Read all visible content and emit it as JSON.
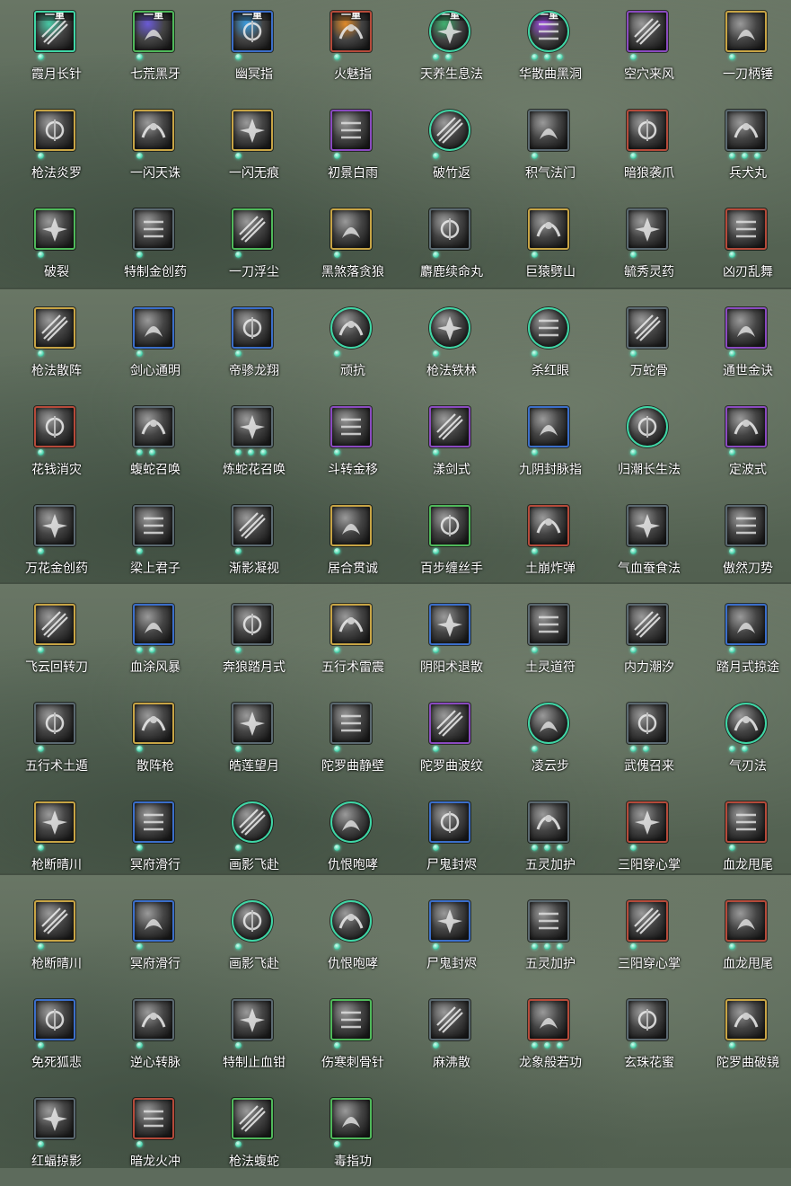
{
  "skills": [
    {
      "label": "霞月长针",
      "tier": "一重",
      "frame": "#3fd6a5",
      "shape": "square",
      "art": "#46c9a5",
      "dots": 1
    },
    {
      "label": "七荒黑牙",
      "tier": "一重",
      "frame": "#4fb85a",
      "shape": "square",
      "art": "#6a5ad6",
      "dots": 1
    },
    {
      "label": "幽冥指",
      "tier": "一重",
      "frame": "#3b6ec9",
      "shape": "square",
      "art": "#3c9de0",
      "dots": 1
    },
    {
      "label": "火魅指",
      "tier": "一重",
      "frame": "#b54a3a",
      "shape": "square",
      "art": "#e08a2a",
      "dots": 1
    },
    {
      "label": "天养生息法",
      "tier": "一重",
      "frame": "#3fd6a5",
      "shape": "circle",
      "art": "#3fb070",
      "dots": 2
    },
    {
      "label": "华散曲黑洞",
      "tier": "一重",
      "frame": "#3fd6a5",
      "shape": "circle",
      "art": "#9a4ae0",
      "dots": 3
    },
    {
      "label": "空穴来风",
      "tier": "",
      "frame": "#8a4ac0",
      "shape": "square",
      "art": "#9a9a9a",
      "dots": 1
    },
    {
      "label": "一刀柄锤",
      "tier": "",
      "frame": "#c7a445",
      "shape": "square",
      "art": "#9a9a9a",
      "dots": 1
    },
    {
      "label": "枪法炎罗",
      "tier": "",
      "frame": "#c7a445",
      "shape": "square",
      "art": "#9a9a9a",
      "dots": 1
    },
    {
      "label": "一闪天诛",
      "tier": "",
      "frame": "#c7a445",
      "shape": "square",
      "art": "#9a9a9a",
      "dots": 1
    },
    {
      "label": "一闪无痕",
      "tier": "",
      "frame": "#c7a445",
      "shape": "square",
      "art": "#9a9a9a",
      "dots": 1
    },
    {
      "label": "初景白雨",
      "tier": "",
      "frame": "#8a4ac0",
      "shape": "square",
      "art": "#9a9a9a",
      "dots": 1
    },
    {
      "label": "破竹返",
      "tier": "",
      "frame": "#3fd6a5",
      "shape": "circle",
      "art": "#9a9a9a",
      "dots": 1
    },
    {
      "label": "积气法门",
      "tier": "",
      "frame": "#5a6870",
      "shape": "square",
      "art": "#9a9a9a",
      "dots": 1
    },
    {
      "label": "暗狼袭爪",
      "tier": "",
      "frame": "#b54a3a",
      "shape": "square",
      "art": "#9a9a9a",
      "dots": 1
    },
    {
      "label": "兵犬丸",
      "tier": "",
      "frame": "#5a6870",
      "shape": "square",
      "art": "#9a9a9a",
      "dots": 3
    },
    {
      "label": "破裂",
      "tier": "",
      "frame": "#4fb85a",
      "shape": "square",
      "art": "#9a9a9a",
      "dots": 1
    },
    {
      "label": "特制金创药",
      "tier": "",
      "frame": "#5a6870",
      "shape": "square",
      "art": "#9a9a9a",
      "dots": 1
    },
    {
      "label": "一刀浮尘",
      "tier": "",
      "frame": "#4fb85a",
      "shape": "square",
      "art": "#9a9a9a",
      "dots": 1
    },
    {
      "label": "黑煞落贪狼",
      "tier": "",
      "frame": "#c7a445",
      "shape": "square",
      "art": "#9a9a9a",
      "dots": 1
    },
    {
      "label": "麝鹿续命丸",
      "tier": "",
      "frame": "#5a6870",
      "shape": "square",
      "art": "#9a9a9a",
      "dots": 1
    },
    {
      "label": "巨猿劈山",
      "tier": "",
      "frame": "#c7a445",
      "shape": "square",
      "art": "#9a9a9a",
      "dots": 1
    },
    {
      "label": "毓秀灵药",
      "tier": "",
      "frame": "#5a6870",
      "shape": "square",
      "art": "#9a9a9a",
      "dots": 1
    },
    {
      "label": "凶刃乱舞",
      "tier": "",
      "frame": "#b54a3a",
      "shape": "square",
      "art": "#9a9a9a",
      "dots": 1
    },
    {
      "label": "枪法散阵",
      "tier": "",
      "frame": "#c7a445",
      "shape": "square",
      "art": "#9a9a9a",
      "dots": 1
    },
    {
      "label": "剑心通明",
      "tier": "",
      "frame": "#3b6ec9",
      "shape": "square",
      "art": "#9a9a9a",
      "dots": 1
    },
    {
      "label": "帝骖龙翔",
      "tier": "",
      "frame": "#3b6ec9",
      "shape": "square",
      "art": "#9a9a9a",
      "dots": 1
    },
    {
      "label": "顽抗",
      "tier": "",
      "frame": "#3fd6a5",
      "shape": "circle",
      "art": "#9a9a9a",
      "dots": 1
    },
    {
      "label": "枪法铁林",
      "tier": "",
      "frame": "#3fd6a5",
      "shape": "circle",
      "art": "#9a9a9a",
      "dots": 1
    },
    {
      "label": "杀红眼",
      "tier": "",
      "frame": "#3fd6a5",
      "shape": "circle",
      "art": "#9a9a9a",
      "dots": 1
    },
    {
      "label": "万蛇骨",
      "tier": "",
      "frame": "#5a6870",
      "shape": "square",
      "art": "#9a9a9a",
      "dots": 1
    },
    {
      "label": "通世金诀",
      "tier": "",
      "frame": "#8a4ac0",
      "shape": "square",
      "art": "#9a9a9a",
      "dots": 1
    },
    {
      "label": "花钱消灾",
      "tier": "",
      "frame": "#b54a3a",
      "shape": "square",
      "art": "#9a9a9a",
      "dots": 1
    },
    {
      "label": "蝮蛇召唤",
      "tier": "",
      "frame": "#5a6870",
      "shape": "square",
      "art": "#9a9a9a",
      "dots": 2
    },
    {
      "label": "炼蛇花召唤",
      "tier": "",
      "frame": "#5a6870",
      "shape": "square",
      "art": "#9a9a9a",
      "dots": 3
    },
    {
      "label": "斗转金移",
      "tier": "",
      "frame": "#8a4ac0",
      "shape": "square",
      "art": "#9a9a9a",
      "dots": 1
    },
    {
      "label": "漾剑式",
      "tier": "",
      "frame": "#8a4ac0",
      "shape": "square",
      "art": "#9a9a9a",
      "dots": 1
    },
    {
      "label": "九阴封脉指",
      "tier": "",
      "frame": "#3b6ec9",
      "shape": "square",
      "art": "#9a9a9a",
      "dots": 1
    },
    {
      "label": "归潮长生法",
      "tier": "",
      "frame": "#3fd6a5",
      "shape": "circle",
      "art": "#9a9a9a",
      "dots": 1
    },
    {
      "label": "定波式",
      "tier": "",
      "frame": "#8a4ac0",
      "shape": "square",
      "art": "#9a9a9a",
      "dots": 1
    },
    {
      "label": "万花金创药",
      "tier": "",
      "frame": "#5a6870",
      "shape": "square",
      "art": "#9a9a9a",
      "dots": 1
    },
    {
      "label": "梁上君子",
      "tier": "",
      "frame": "#5a6870",
      "shape": "square",
      "art": "#9a9a9a",
      "dots": 1
    },
    {
      "label": "渐影凝视",
      "tier": "",
      "frame": "#5a6870",
      "shape": "square",
      "art": "#9a9a9a",
      "dots": 1
    },
    {
      "label": "居合贯诚",
      "tier": "",
      "frame": "#c7a445",
      "shape": "square",
      "art": "#9a9a9a",
      "dots": 1
    },
    {
      "label": "百步缠丝手",
      "tier": "",
      "frame": "#4fb85a",
      "shape": "square",
      "art": "#9a9a9a",
      "dots": 1
    },
    {
      "label": "土崩炸弹",
      "tier": "",
      "frame": "#b54a3a",
      "shape": "square",
      "art": "#9a9a9a",
      "dots": 1
    },
    {
      "label": "气血蚕食法",
      "tier": "",
      "frame": "#5a6870",
      "shape": "square",
      "art": "#9a9a9a",
      "dots": 1
    },
    {
      "label": "傲然刀势",
      "tier": "",
      "frame": "#5a6870",
      "shape": "square",
      "art": "#9a9a9a",
      "dots": 1
    },
    {
      "label": "飞云回转刀",
      "tier": "",
      "frame": "#c7a445",
      "shape": "square",
      "art": "#9a9a9a",
      "dots": 1
    },
    {
      "label": "血涂风暴",
      "tier": "",
      "frame": "#3b6ec9",
      "shape": "square",
      "art": "#9a9a9a",
      "dots": 2
    },
    {
      "label": "奔狼踏月式",
      "tier": "",
      "frame": "#5a6870",
      "shape": "square",
      "art": "#9a9a9a",
      "dots": 1
    },
    {
      "label": "五行术雷震",
      "tier": "",
      "frame": "#c7a445",
      "shape": "square",
      "art": "#9a9a9a",
      "dots": 1
    },
    {
      "label": "阴阳术退散",
      "tier": "",
      "frame": "#3b6ec9",
      "shape": "square",
      "art": "#9a9a9a",
      "dots": 1
    },
    {
      "label": "土灵道符",
      "tier": "",
      "frame": "#5a6870",
      "shape": "square",
      "art": "#9a9a9a",
      "dots": 1
    },
    {
      "label": "内力潮汐",
      "tier": "",
      "frame": "#5a6870",
      "shape": "square",
      "art": "#9a9a9a",
      "dots": 1
    },
    {
      "label": "踏月式掠途",
      "tier": "",
      "frame": "#3b6ec9",
      "shape": "square",
      "art": "#9a9a9a",
      "dots": 1
    },
    {
      "label": "五行术土遁",
      "tier": "",
      "frame": "#5a6870",
      "shape": "square",
      "art": "#9a9a9a",
      "dots": 1
    },
    {
      "label": "散阵枪",
      "tier": "",
      "frame": "#c7a445",
      "shape": "square",
      "art": "#9a9a9a",
      "dots": 1
    },
    {
      "label": "皓莲望月",
      "tier": "",
      "frame": "#5a6870",
      "shape": "square",
      "art": "#9a9a9a",
      "dots": 1
    },
    {
      "label": "陀罗曲静壁",
      "tier": "",
      "frame": "#5a6870",
      "shape": "square",
      "art": "#9a9a9a",
      "dots": 1
    },
    {
      "label": "陀罗曲波纹",
      "tier": "",
      "frame": "#8a4ac0",
      "shape": "square",
      "art": "#9a9a9a",
      "dots": 1
    },
    {
      "label": "凌云步",
      "tier": "",
      "frame": "#3fd6a5",
      "shape": "circle",
      "art": "#9a9a9a",
      "dots": 1
    },
    {
      "label": "武傀召来",
      "tier": "",
      "frame": "#5a6870",
      "shape": "square",
      "art": "#9a9a9a",
      "dots": 2
    },
    {
      "label": "气刃法",
      "tier": "",
      "frame": "#3fd6a5",
      "shape": "circle",
      "art": "#9a9a9a",
      "dots": 2
    },
    {
      "label": "枪断晴川",
      "tier": "",
      "frame": "#c7a445",
      "shape": "square",
      "art": "#9a9a9a",
      "dots": 1
    },
    {
      "label": "冥府滑行",
      "tier": "",
      "frame": "#3b6ec9",
      "shape": "square",
      "art": "#9a9a9a",
      "dots": 1
    },
    {
      "label": "画影飞赴",
      "tier": "",
      "frame": "#3fd6a5",
      "shape": "circle",
      "art": "#9a9a9a",
      "dots": 1
    },
    {
      "label": "仇恨咆哮",
      "tier": "",
      "frame": "#3fd6a5",
      "shape": "circle",
      "art": "#9a9a9a",
      "dots": 1
    },
    {
      "label": "尸鬼封烬",
      "tier": "",
      "frame": "#3b6ec9",
      "shape": "square",
      "art": "#9a9a9a",
      "dots": 1
    },
    {
      "label": "五灵加护",
      "tier": "",
      "frame": "#5a6870",
      "shape": "square",
      "art": "#9a9a9a",
      "dots": 3
    },
    {
      "label": "三阳穿心掌",
      "tier": "",
      "frame": "#b54a3a",
      "shape": "square",
      "art": "#9a9a9a",
      "dots": 1
    },
    {
      "label": "血龙甩尾",
      "tier": "",
      "frame": "#b54a3a",
      "shape": "square",
      "art": "#9a9a9a",
      "dots": 1
    },
    {
      "label": "枪断晴川",
      "tier": "",
      "frame": "#c7a445",
      "shape": "square",
      "art": "#9a9a9a",
      "dots": 1
    },
    {
      "label": "冥府滑行",
      "tier": "",
      "frame": "#3b6ec9",
      "shape": "square",
      "art": "#9a9a9a",
      "dots": 1
    },
    {
      "label": "画影飞赴",
      "tier": "",
      "frame": "#3fd6a5",
      "shape": "circle",
      "art": "#9a9a9a",
      "dots": 1
    },
    {
      "label": "仇恨咆哮",
      "tier": "",
      "frame": "#3fd6a5",
      "shape": "circle",
      "art": "#9a9a9a",
      "dots": 1
    },
    {
      "label": "尸鬼封烬",
      "tier": "",
      "frame": "#3b6ec9",
      "shape": "square",
      "art": "#9a9a9a",
      "dots": 1
    },
    {
      "label": "五灵加护",
      "tier": "",
      "frame": "#5a6870",
      "shape": "square",
      "art": "#9a9a9a",
      "dots": 3
    },
    {
      "label": "三阳穿心掌",
      "tier": "",
      "frame": "#b54a3a",
      "shape": "square",
      "art": "#9a9a9a",
      "dots": 1
    },
    {
      "label": "血龙甩尾",
      "tier": "",
      "frame": "#b54a3a",
      "shape": "square",
      "art": "#9a9a9a",
      "dots": 1
    },
    {
      "label": "免死狐悲",
      "tier": "",
      "frame": "#3b6ec9",
      "shape": "square",
      "art": "#9a9a9a",
      "dots": 1
    },
    {
      "label": "逆心转脉",
      "tier": "",
      "frame": "#5a6870",
      "shape": "square",
      "art": "#9a9a9a",
      "dots": 1
    },
    {
      "label": "特制止血钳",
      "tier": "",
      "frame": "#5a6870",
      "shape": "square",
      "art": "#9a9a9a",
      "dots": 1
    },
    {
      "label": "伤寒刺骨针",
      "tier": "",
      "frame": "#4fb85a",
      "shape": "square",
      "art": "#9a9a9a",
      "dots": 1
    },
    {
      "label": "麻沸散",
      "tier": "",
      "frame": "#5a6870",
      "shape": "square",
      "art": "#9a9a9a",
      "dots": 1
    },
    {
      "label": "龙象般若功",
      "tier": "",
      "frame": "#b54a3a",
      "shape": "square",
      "art": "#9a9a9a",
      "dots": 3
    },
    {
      "label": "玄珠花蜜",
      "tier": "",
      "frame": "#5a6870",
      "shape": "square",
      "art": "#9a9a9a",
      "dots": 1
    },
    {
      "label": "陀罗曲破镜",
      "tier": "",
      "frame": "#c7a445",
      "shape": "square",
      "art": "#9a9a9a",
      "dots": 1
    },
    {
      "label": "红蝠掠影",
      "tier": "",
      "frame": "#5a6870",
      "shape": "square",
      "art": "#9a9a9a",
      "dots": 1
    },
    {
      "label": "暗龙火冲",
      "tier": "",
      "frame": "#b54a3a",
      "shape": "square",
      "art": "#9a9a9a",
      "dots": 1
    },
    {
      "label": "枪法蝮蛇",
      "tier": "",
      "frame": "#4fb85a",
      "shape": "square",
      "art": "#9a9a9a",
      "dots": 1
    },
    {
      "label": "毒指功",
      "tier": "",
      "frame": "#4fb85a",
      "shape": "square",
      "art": "#9a9a9a",
      "dots": 1
    }
  ]
}
